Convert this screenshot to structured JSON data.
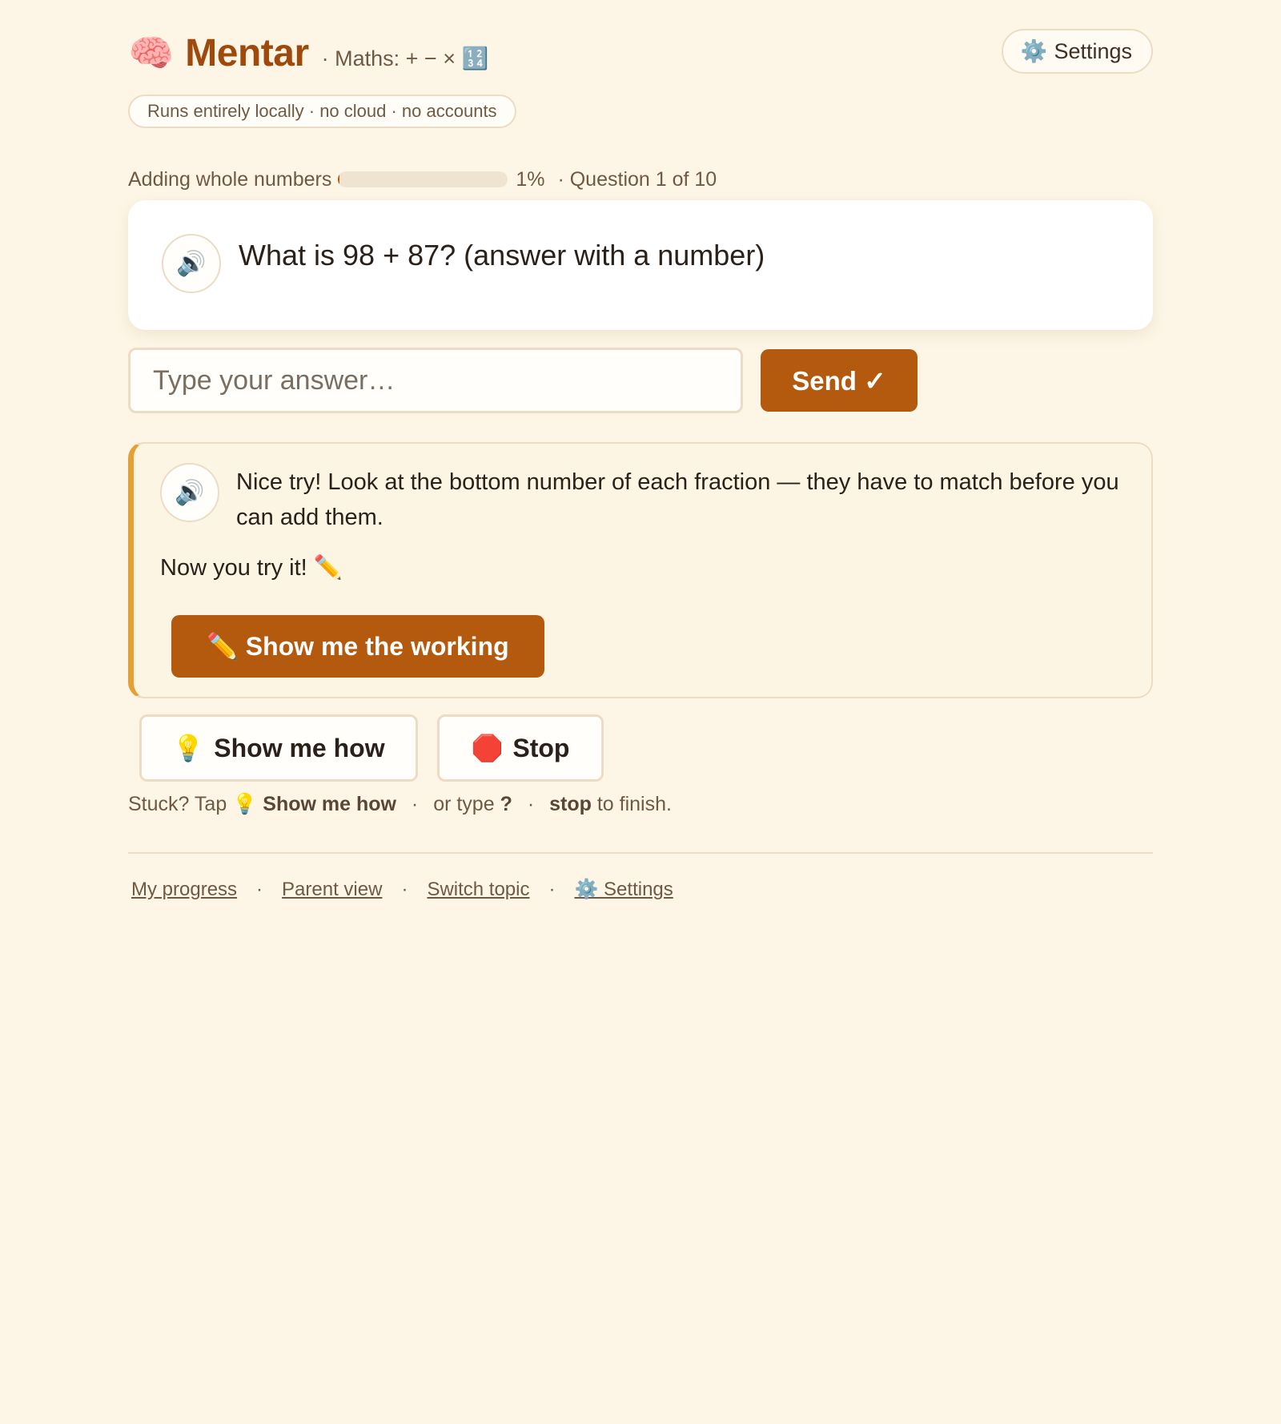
{
  "header": {
    "brand_icon": "🧠",
    "brand_name": "Mentar",
    "subtitle": "· Maths: + − × 🔢",
    "settings_icon": "⚙️",
    "settings_label": "Settings"
  },
  "privacy_pill": "Runs entirely locally · no cloud · no accounts",
  "progress": {
    "topic": "Adding whole numbers",
    "percent_value": 1,
    "percent_label": "1%",
    "question_label": "· Question 1 of 10"
  },
  "question": {
    "speaker_icon": "🔊",
    "text": "What is 98 + 87? (answer with a number)"
  },
  "answer": {
    "placeholder": "Type your answer…",
    "value": "",
    "send_label": "Send ✓"
  },
  "feedback": {
    "speaker_icon": "🔊",
    "message": "Nice try! Look at the bottom number of each fraction — they have to match before you can add them.",
    "prompt": "Now you try it! ✏️",
    "working_button": "✏️ Show me the working"
  },
  "actions": {
    "help_icon": "💡",
    "help_label": "Show me how",
    "stop_icon": "🛑",
    "stop_label": "Stop"
  },
  "hint": {
    "prefix": "Stuck? Tap 💡",
    "help": "Show me how",
    "or_type": "or type",
    "question_mark": "?",
    "stop_word": "stop",
    "suffix": "to finish."
  },
  "footer": {
    "links": [
      "My progress",
      "Parent view",
      "Switch topic",
      "⚙️ Settings"
    ]
  },
  "colors": {
    "background": "#fdf6e6",
    "brand": "#9e4a0c",
    "accent": "#b45a0f",
    "feedback_border": "#e2a035"
  }
}
